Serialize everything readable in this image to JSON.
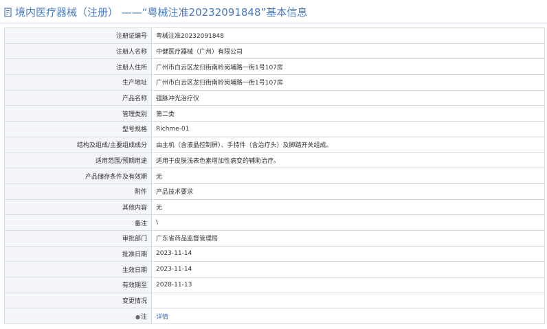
{
  "header": {
    "title": "境内医疗器械（注册） ——“粤械注准20232091848”基本信息"
  },
  "colors": {
    "accent": "#4a79c0",
    "label_bg": "#f3f5f8",
    "border": "#d5dbe4",
    "link": "#3a6fc4"
  },
  "rows": [
    {
      "label": "注册证编号",
      "value": "粤械注准20232091848"
    },
    {
      "label": "注册人名称",
      "value": "中健医疗器械（广州）有限公司"
    },
    {
      "label": "注册人住所",
      "value": "广州市白云区龙归街南岭岗埔路一街1号107房"
    },
    {
      "label": "生产地址",
      "value": "广州市白云区龙归街南岭岗埔路一街1号107房"
    },
    {
      "label": "产品名称",
      "value": "强脉冲光治疗仪"
    },
    {
      "label": "管理类别",
      "value": "第二类"
    },
    {
      "label": "型号规格",
      "value": "Richme-01"
    },
    {
      "label": "结构及组成/主要组成成分",
      "value": "由主机（含液晶控制屏）、手持件（含治疗头）及脚踏开关组成。"
    },
    {
      "label": "适用范围/预期用途",
      "value": "适用于皮肤浅表色素增加性病变的辅助治疗。"
    },
    {
      "label": "产品储存条件及有效期",
      "value": "无"
    },
    {
      "label": "附件",
      "value": "产品技术要求"
    },
    {
      "label": "其他内容",
      "value": "无"
    },
    {
      "label": "备注",
      "value": "\\"
    },
    {
      "label": "审批部门",
      "value": "广东省药品监督管理局"
    },
    {
      "label": "批准日期",
      "value": "2023-11-14"
    },
    {
      "label": "生效日期",
      "value": "2023-11-14"
    },
    {
      "label": "有效期至",
      "value": "2028-11-13"
    },
    {
      "label": "变更情况",
      "value": ""
    }
  ],
  "note_row": {
    "pin_icon": "location-pin-icon",
    "label": "注",
    "link_text": "详情"
  }
}
